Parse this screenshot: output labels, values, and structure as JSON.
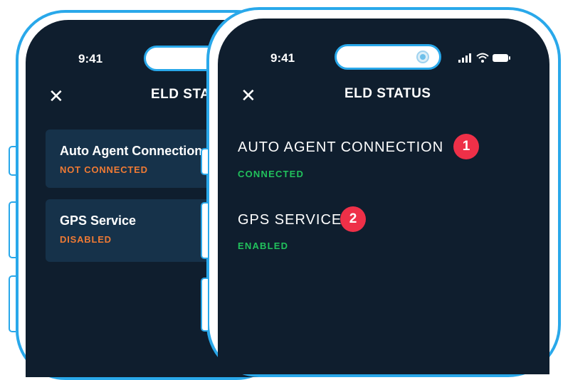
{
  "colors": {
    "frame": "#29a8ea",
    "screen_bg": "#0f1e2e",
    "card_bg": "#16324a",
    "connected": "#21c15c",
    "disconnected": "#ef7a34",
    "badge": "#ee3048"
  },
  "back_phone": {
    "time": "9:41",
    "title": "ELD STATUS",
    "close_icon": "close-icon",
    "cards": [
      {
        "name": "Auto Agent Connection",
        "status": "NOT CONNECTED"
      },
      {
        "name": "GPS Service",
        "status": "DISABLED"
      }
    ]
  },
  "front_phone": {
    "time": "9:41",
    "title": "ELD STATUS",
    "close_icon": "close-icon",
    "status_icons": [
      "signal-icon",
      "wifi-icon",
      "battery-icon"
    ],
    "items": [
      {
        "name": "AUTO AGENT CONNECTION",
        "status": "CONNECTED",
        "badge": "1"
      },
      {
        "name": "GPS SERVICE",
        "status": "ENABLED",
        "badge": "2"
      }
    ]
  }
}
